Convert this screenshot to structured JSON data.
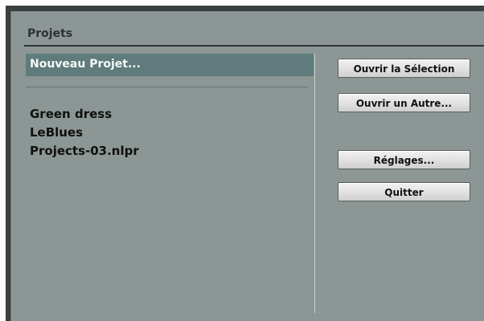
{
  "panel": {
    "title": "Projets"
  },
  "list": {
    "new_project": "Nouveau Projet...",
    "recent": [
      "Green dress",
      "LeBlues",
      "Projects-03.nlpr"
    ]
  },
  "buttons": {
    "open_selection": "Ouvrir la Sélection",
    "open_other": "Ouvrir un Autre...",
    "settings": "Réglages...",
    "quit": "Quitter"
  },
  "colors": {
    "panel_bg": "#8c9695",
    "selection_bg": "#5f7b7c",
    "selection_text": "#f4f7f7",
    "title_text": "#2c3131"
  }
}
